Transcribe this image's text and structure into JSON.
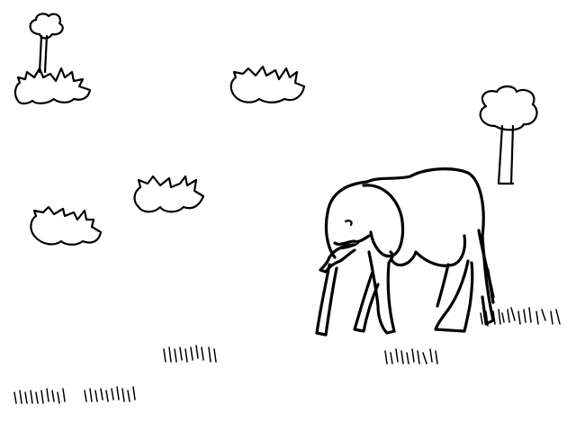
{
  "scene": {
    "background_color": "#ffffff",
    "ink_color": "#000000",
    "style": "black line drawing on white",
    "subjects": [
      "elephant",
      "tree",
      "tree",
      "bush",
      "bush",
      "bush",
      "bush",
      "grass",
      "grass",
      "grass",
      "grass",
      "grass"
    ]
  }
}
